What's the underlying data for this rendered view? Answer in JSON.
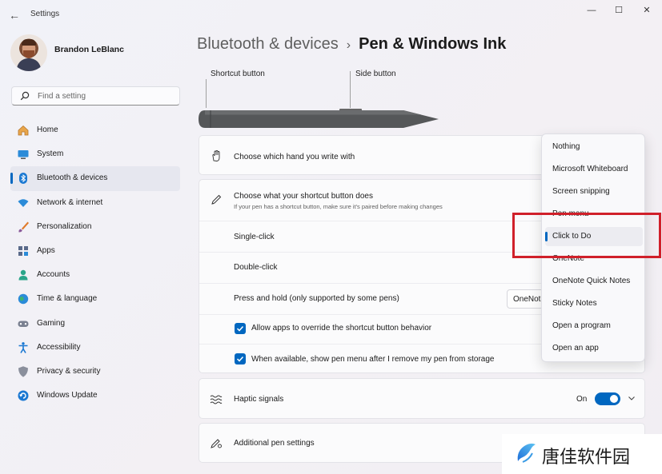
{
  "titlebar": {
    "app_title": "Settings",
    "back_glyph": "←",
    "minimize_glyph": "—",
    "maximize_glyph": "☐",
    "close_glyph": "✕"
  },
  "user": {
    "name": "Brandon LeBlanc"
  },
  "search": {
    "placeholder": "Find a setting"
  },
  "sidebar": {
    "items": [
      {
        "label": "Home",
        "icon": "home-icon"
      },
      {
        "label": "System",
        "icon": "system-icon"
      },
      {
        "label": "Bluetooth & devices",
        "icon": "bluetooth-icon",
        "active": true
      },
      {
        "label": "Network & internet",
        "icon": "wifi-icon"
      },
      {
        "label": "Personalization",
        "icon": "brush-icon"
      },
      {
        "label": "Apps",
        "icon": "apps-icon"
      },
      {
        "label": "Accounts",
        "icon": "accounts-icon"
      },
      {
        "label": "Time & language",
        "icon": "globe-icon"
      },
      {
        "label": "Gaming",
        "icon": "gamepad-icon"
      },
      {
        "label": "Accessibility",
        "icon": "accessibility-icon"
      },
      {
        "label": "Privacy & security",
        "icon": "shield-icon"
      },
      {
        "label": "Windows Update",
        "icon": "update-icon"
      }
    ]
  },
  "breadcrumb": {
    "parent": "Bluetooth & devices",
    "separator": "›",
    "current": "Pen & Windows Ink"
  },
  "pen_diagram": {
    "shortcut_label": "Shortcut button",
    "side_label": "Side button"
  },
  "settings": {
    "hand": {
      "label": "Choose which hand you write with"
    },
    "shortcut": {
      "label": "Choose what your shortcut button does",
      "sublabel": "If your pen has a shortcut button, make sure it's paired before making changes",
      "single_click": "Single-click",
      "double_click": "Double-click",
      "press_hold": "Press and hold (only supported by some pens)",
      "press_hold_value": "OneNote",
      "allow_override": "Allow apps to override the shortcut button behavior",
      "show_pen_menu": "When available, show pen menu after I remove my pen from storage"
    },
    "haptic": {
      "label": "Haptic signals",
      "state": "On"
    },
    "additional": {
      "label": "Additional pen settings"
    }
  },
  "menu": {
    "items": [
      {
        "label": "Nothing"
      },
      {
        "label": "Microsoft Whiteboard"
      },
      {
        "label": "Screen snipping"
      },
      {
        "label": "Pen menu"
      },
      {
        "label": "Click to Do",
        "selected": true
      },
      {
        "label": "OneNote"
      },
      {
        "label": "OneNote Quick Notes"
      },
      {
        "label": "Sticky Notes"
      },
      {
        "label": "Open a program"
      },
      {
        "label": "Open an app"
      }
    ]
  },
  "colors": {
    "accent": "#0067c0",
    "highlight_box": "#d0202a"
  },
  "watermark": {
    "text": "唐佳软件园"
  }
}
